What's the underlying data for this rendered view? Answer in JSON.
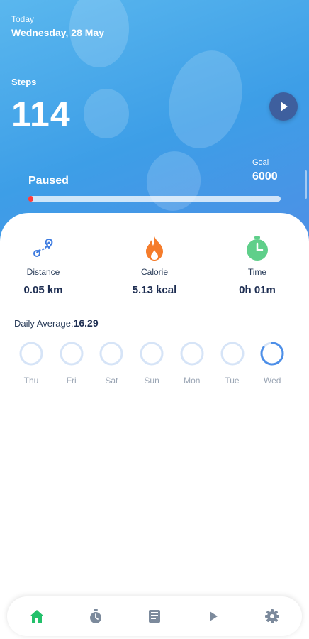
{
  "header": {
    "date_label": "Today",
    "date_value": "Wednesday, 28 May",
    "steps_label": "Steps",
    "steps_value": "114",
    "status": "Paused",
    "goal_label": "Goal",
    "goal_value": "6000",
    "progress_fraction": 0.019
  },
  "metrics": [
    {
      "icon": "route-icon",
      "label": "Distance",
      "value": "0.05 km"
    },
    {
      "icon": "flame-icon",
      "label": "Calorie",
      "value": "5.13 kcal"
    },
    {
      "icon": "timer-icon",
      "label": "Time",
      "value": "0h 01m"
    }
  ],
  "daily_average": {
    "label": "Daily Average:",
    "value": "16.29"
  },
  "days": [
    {
      "name": "Thu",
      "fraction": 0
    },
    {
      "name": "Fri",
      "fraction": 0
    },
    {
      "name": "Sat",
      "fraction": 0
    },
    {
      "name": "Sun",
      "fraction": 0
    },
    {
      "name": "Mon",
      "fraction": 0
    },
    {
      "name": "Tue",
      "fraction": 0
    },
    {
      "name": "Wed",
      "fraction": 0.85
    }
  ],
  "nav": [
    {
      "icon": "home-icon",
      "active": true
    },
    {
      "icon": "stopwatch-icon",
      "active": false
    },
    {
      "icon": "book-icon",
      "active": false
    },
    {
      "icon": "play-icon",
      "active": false
    },
    {
      "icon": "gear-icon",
      "active": false
    }
  ],
  "colors": {
    "accent_blue": "#4d90e6",
    "ring_inactive": "#d6e4f7",
    "ring_active": "#4d8fe8",
    "flame": "#f57c2b",
    "timer": "#5fcf8a",
    "nav_active": "#22c06a",
    "nav_inactive": "#7c8a9c",
    "progress": "#ff3b3b"
  }
}
